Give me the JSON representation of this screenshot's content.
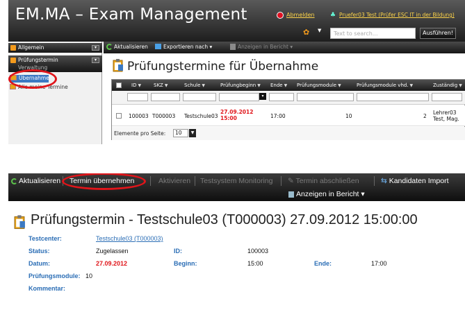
{
  "app": {
    "title": "EM.MA – Exam Management",
    "logout": "Abmelden",
    "user": "Pruefer03 Test (Prüfer ESC IT in der Bildung)",
    "search_placeholder": "Text to search...",
    "search_button": "Ausführen!"
  },
  "sidebar": {
    "sections": [
      {
        "label": "Allgemein"
      },
      {
        "label": "Prüfungstermin",
        "sublabel": "Verwaltung"
      }
    ],
    "items": [
      {
        "label": "Übernahme"
      },
      {
        "label": "Alle meine Termine"
      }
    ]
  },
  "toolbar1": {
    "refresh": "Aktualisieren",
    "export": "Exportieren nach",
    "report": "Anzeigen in Bericht"
  },
  "list_page": {
    "title": "Prüfungstermine für Übernahme",
    "columns": [
      "ID",
      "SKZ",
      "Schule",
      "Prüfungbeginn",
      "Ende",
      "Prüfungsmodule",
      "Prüfungsmodule vhd.",
      "Zuständig"
    ],
    "rows": [
      {
        "id": "100003",
        "skz": "T000003",
        "schule": "Testschule03",
        "beginn": "27.09.2012 15:00",
        "ende": "17:00",
        "module": "10",
        "module_vhd": "2",
        "zustaendig": "Lehrer03 Test, Mag."
      }
    ],
    "page_size_label": "Elemente pro Seite:",
    "page_size": "10"
  },
  "toolbar2": {
    "refresh": "Aktualisieren",
    "take_over": "Termin übernehmen",
    "activate": "Aktivieren",
    "monitoring": "Testsystem Monitoring",
    "close": "Termin abschließen",
    "import": "Kandidaten Import",
    "report": "Anzeigen in Bericht"
  },
  "detail": {
    "title": "Prüfungstermin - Testschule03 (T000003) 27.09.2012 15:00:00",
    "testcenter_label": "Testcenter:",
    "testcenter_value": "Testschule03 (T000003)",
    "status_label": "Status:",
    "status_value": "Zugelassen",
    "id_label": "ID:",
    "id_value": "100003",
    "datum_label": "Datum:",
    "datum_value": "27.09.2012",
    "beginn_label": "Beginn:",
    "beginn_value": "15:00",
    "ende_label": "Ende:",
    "ende_value": "17:00",
    "module_label": "Prüfungsmodule:",
    "module_value": "10",
    "kommentar_label": "Kommentar:"
  },
  "colors": {
    "accent_blue": "#2a6db5",
    "alert_red": "#e0151a",
    "link_yellow": "#ffd54a"
  }
}
